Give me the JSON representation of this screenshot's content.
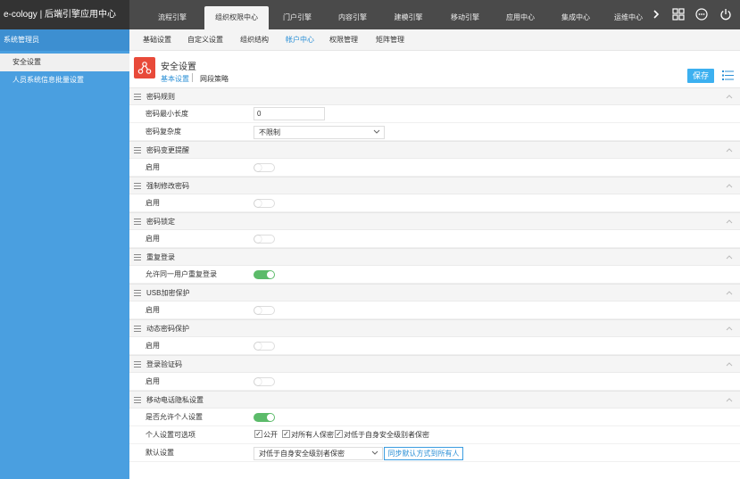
{
  "brand": "e-cology | 后端引擎应用中心",
  "top_tabs": [
    {
      "label": "流程引擎"
    },
    {
      "label": "组织权限中心"
    },
    {
      "label": "门户引擎"
    },
    {
      "label": "内容引擎"
    },
    {
      "label": "建模引擎"
    },
    {
      "label": "移动引擎"
    },
    {
      "label": "应用中心"
    },
    {
      "label": "集成中心"
    },
    {
      "label": "运维中心"
    }
  ],
  "top_icons": [
    "chevron-right-icon",
    "grid-icon",
    "more-icon",
    "power-icon"
  ],
  "sidebar": {
    "title": "系统管理员",
    "items": [
      {
        "label": "安全设置"
      },
      {
        "label": "人员系统信息批量设置"
      }
    ]
  },
  "sub_tabs": [
    {
      "label": "基础设置"
    },
    {
      "label": "自定义设置"
    },
    {
      "label": "组织结构"
    },
    {
      "label": "帐户中心"
    },
    {
      "label": "权限管理"
    },
    {
      "label": "矩阵管理"
    }
  ],
  "page": {
    "title": "安全设置",
    "tab1": "基本设置",
    "tab2": "网段策略",
    "save_label": "保存"
  },
  "sections": {
    "pwd_rules": {
      "title": "密码规则",
      "min_len_label": "密码最小长度",
      "min_len_value": "0",
      "complexity_label": "密码复杂度",
      "complexity_value": "不限制"
    },
    "pwd_change": {
      "title": "密码变更提醒",
      "enable_label": "启用",
      "enabled": false
    },
    "force_change": {
      "title": "强制修改密码",
      "enable_label": "启用",
      "enabled": false
    },
    "pwd_lock": {
      "title": "密码锁定",
      "enable_label": "启用",
      "enabled": false
    },
    "relogin": {
      "title": "重复登录",
      "allow_label": "允许同一用户重复登录",
      "enabled": true
    },
    "usb": {
      "title": "USB加密保护",
      "enable_label": "启用",
      "enabled": false
    },
    "dynamic": {
      "title": "动态密码保护",
      "enable_label": "启用",
      "enabled": false
    },
    "captcha": {
      "title": "登录验证码",
      "enable_label": "启用",
      "enabled": false
    },
    "privacy": {
      "title": "移动电话隐私设置",
      "allow_personal_label": "是否允许个人设置",
      "allow_personal_enabled": true,
      "options_label": "个人设置可选项",
      "options": [
        {
          "label": "公开",
          "checked": true
        },
        {
          "label": "对所有人保密",
          "checked": true
        },
        {
          "label": "对低于自身安全级别者保密",
          "checked": true
        }
      ],
      "default_label": "默认设置",
      "default_value": "对低于自身安全级别者保密",
      "sync_label": "同步默认方式到所有人"
    }
  },
  "colors": {
    "accent": "#2a8fd6",
    "sidebar": "#4a9fe0",
    "toggle_on": "#5cbb6a",
    "save": "#3cb0f0",
    "page_icon": "#e84a3a"
  }
}
